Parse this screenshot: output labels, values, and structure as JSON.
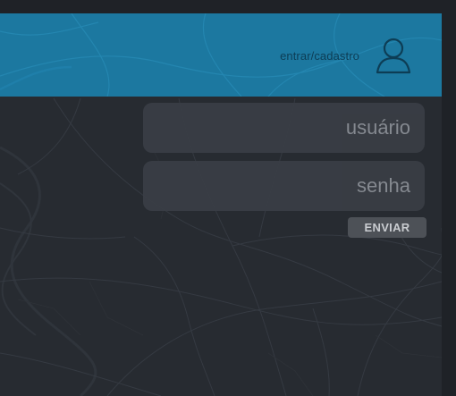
{
  "header": {
    "login_link": "entrar/cadastro",
    "user_icon": "user-icon",
    "background_color": "#1c78a0"
  },
  "form": {
    "username_placeholder": "usuário",
    "password_placeholder": "senha",
    "submit_label": "ENVIAR"
  },
  "theme": {
    "panel_color": "#272b31",
    "field_color": "#3a3e45",
    "button_color": "#4d5157"
  }
}
